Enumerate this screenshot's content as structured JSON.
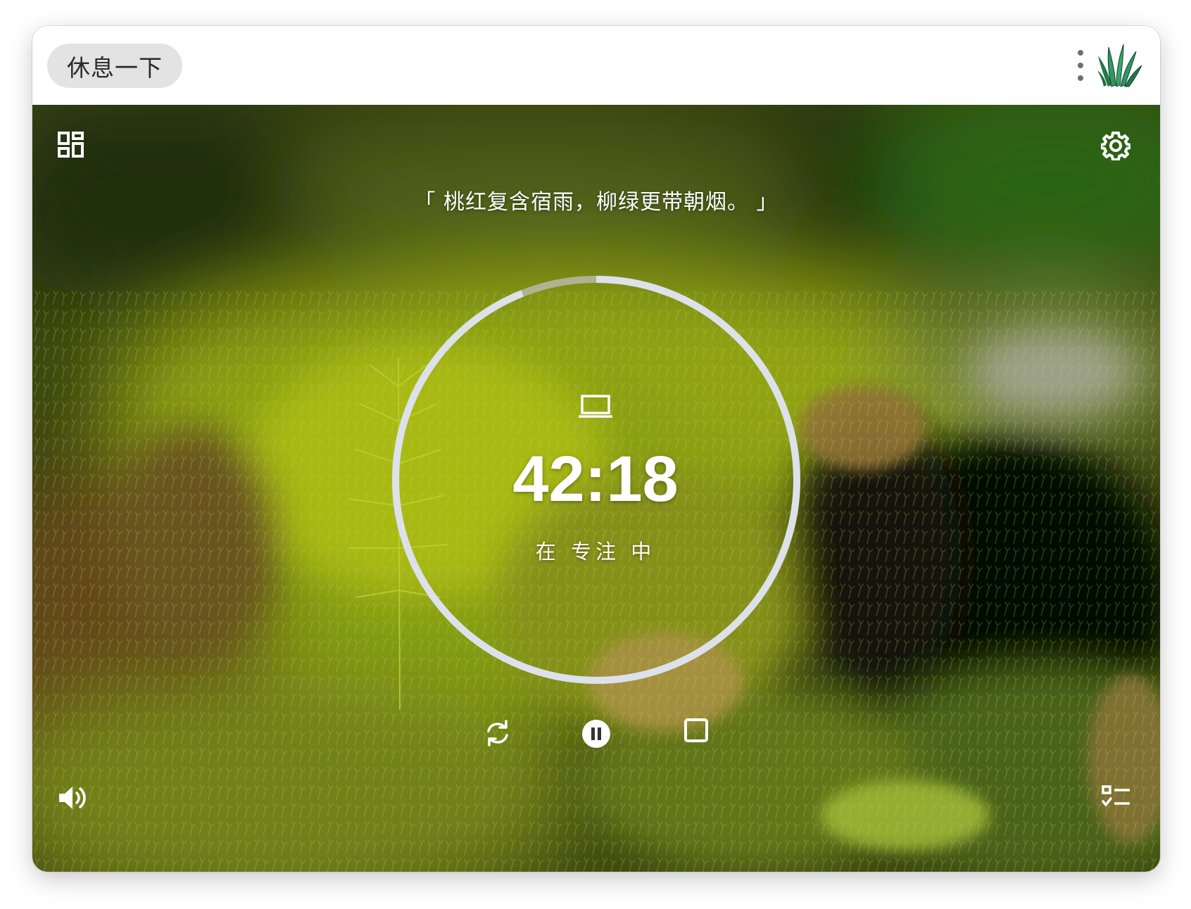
{
  "header": {
    "break_button_label": "休息一下",
    "menu_icon": "more-vertical-icon",
    "logo_icon": "grass-logo-icon"
  },
  "scene": {
    "quote": "「 桃红复含宿雨，柳绿更带朝烟。 」",
    "top_left_icon": "dashboard-grid-icon",
    "top_right_icon": "gear-icon",
    "timer": {
      "mode_icon": "laptop-icon",
      "time": "42:18",
      "status": "在 专注 中",
      "remaining_fraction": 0.94
    },
    "controls": [
      "restart-icon",
      "pause-icon",
      "stop-icon"
    ],
    "bottom_left_icon": "volume-icon",
    "bottom_right_icon": "task-list-icon"
  },
  "colors": {
    "ring": "#dde1ea",
    "ring_elapsed": "#b9b9a8",
    "pill_bg": "#e3e3e3",
    "grass_logo": "#2e9a62"
  }
}
